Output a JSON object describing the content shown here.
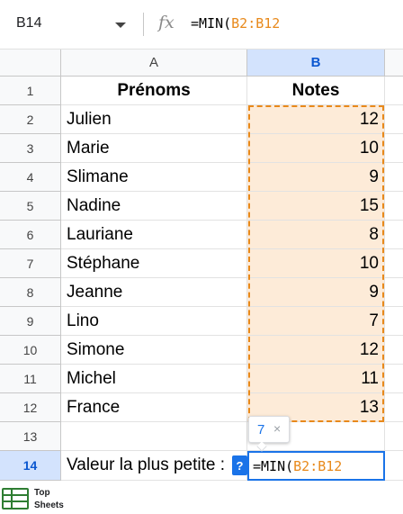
{
  "formula_bar": {
    "cell_ref": "B14",
    "fx_label": "fx",
    "formula_prefix": "=MIN(",
    "formula_range": "B2:B12"
  },
  "columns": {
    "a": "A",
    "b": "B"
  },
  "rows": [
    {
      "num": "1",
      "a": "Prénoms",
      "b": "Notes"
    },
    {
      "num": "2",
      "a": "Julien",
      "b": "12"
    },
    {
      "num": "3",
      "a": "Marie",
      "b": "10"
    },
    {
      "num": "4",
      "a": "Slimane",
      "b": "9"
    },
    {
      "num": "5",
      "a": "Nadine",
      "b": "15"
    },
    {
      "num": "6",
      "a": "Lauriane",
      "b": "8"
    },
    {
      "num": "7",
      "a": "Stéphane",
      "b": "10"
    },
    {
      "num": "8",
      "a": "Jeanne",
      "b": "9"
    },
    {
      "num": "9",
      "a": "Lino",
      "b": "7"
    },
    {
      "num": "10",
      "a": "Simone",
      "b": "12"
    },
    {
      "num": "11",
      "a": "Michel",
      "b": "11"
    },
    {
      "num": "12",
      "a": "France",
      "b": "13"
    },
    {
      "num": "13",
      "a": "",
      "b": ""
    },
    {
      "num": "14",
      "a": "Valeur la plus petite :",
      "b": ""
    }
  ],
  "editor": {
    "help_label": "?",
    "formula_prefix": "=MIN(",
    "formula_range": "B2:B12"
  },
  "tooltip": {
    "value": "7",
    "close": "×"
  },
  "logo": {
    "line1": "Top",
    "line2": "Sheets"
  },
  "colors": {
    "range_orange": "#e8891b",
    "range_fill": "#fdebd8",
    "selection_blue": "#1a73e8",
    "header_active": "#d3e3fd"
  }
}
